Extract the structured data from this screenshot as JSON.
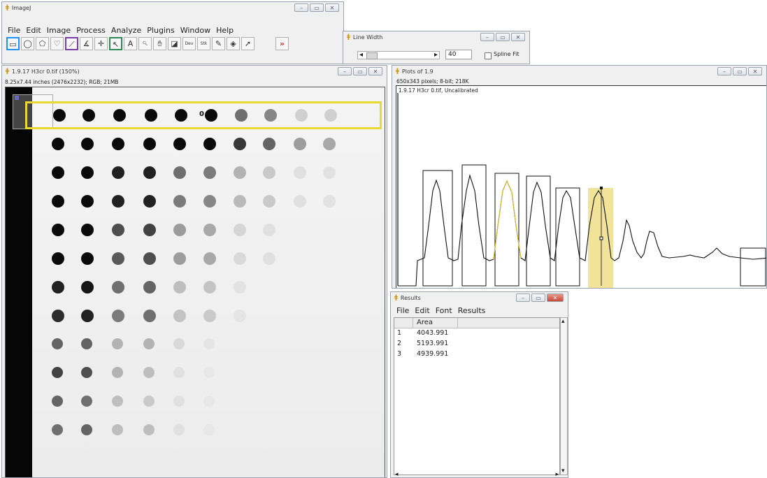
{
  "imagej": {
    "title": "ImageJ",
    "menu": [
      "File",
      "Edit",
      "Image",
      "Process",
      "Analyze",
      "Plugins",
      "Window",
      "Help"
    ],
    "tools": [
      {
        "name": "rectangle-tool-icon",
        "glyph": "▭",
        "highlight": "#1e90ff"
      },
      {
        "name": "oval-tool-icon",
        "glyph": "◯",
        "highlight": ""
      },
      {
        "name": "polygon-tool-icon",
        "glyph": "⬠",
        "highlight": ""
      },
      {
        "name": "freehand-tool-icon",
        "glyph": "♡",
        "highlight": ""
      },
      {
        "name": "straight-line-tool-icon",
        "glyph": "⟋",
        "highlight": "#7a3fa6"
      },
      {
        "name": "angle-tool-icon",
        "glyph": "∡",
        "highlight": ""
      },
      {
        "name": "point-tool-icon",
        "glyph": "✛",
        "highlight": ""
      },
      {
        "name": "wand-tool-icon",
        "glyph": "↖",
        "highlight": "#2e8b57"
      },
      {
        "name": "text-tool-icon",
        "glyph": "A",
        "highlight": ""
      },
      {
        "name": "magnifier-tool-icon",
        "glyph": "🔍︎",
        "highlight": ""
      },
      {
        "name": "hand-tool-icon",
        "glyph": "✋︎",
        "highlight": ""
      },
      {
        "name": "color-picker-tool-icon",
        "glyph": "◪",
        "highlight": ""
      },
      {
        "name": "developer-menu-tool-icon",
        "glyph": "Dev",
        "highlight": ""
      },
      {
        "name": "stacks-menu-tool-icon",
        "glyph": "Stk",
        "highlight": ""
      },
      {
        "name": "brush-tool-icon",
        "glyph": "✎",
        "highlight": ""
      },
      {
        "name": "flood-fill-tool-icon",
        "glyph": "◈",
        "highlight": ""
      },
      {
        "name": "arrow-tool-icon",
        "glyph": "➚",
        "highlight": ""
      },
      {
        "name": "more-tools-icon",
        "glyph": "»",
        "highlight": ""
      }
    ]
  },
  "line_width": {
    "title": "Line Width",
    "value": "40",
    "spline_label": "Spline Fit",
    "scroll_left": "◂",
    "scroll_right": "▸"
  },
  "image_window": {
    "title": "1.9.17 H3cr 0.tif (150%)",
    "info": "8.25x7.44 inches (2476x2232); RGB; 21MB",
    "selection_color": "#e8d830",
    "lane_number": "0"
  },
  "plot_window": {
    "title": "Plots of 1.9",
    "info": "650x343 pixels; 8-bit; 218K",
    "label": "1.9.17 H3cr 0.tif, Uncalibrated",
    "highlight_color": "#f2e39a"
  },
  "results": {
    "title": "Results",
    "menu": [
      "File",
      "Edit",
      "Font",
      "Results"
    ],
    "column": "Area",
    "rows": [
      {
        "n": "1",
        "area": "4043.991"
      },
      {
        "n": "2",
        "area": "5193.991"
      },
      {
        "n": "3",
        "area": "4939.991"
      }
    ],
    "scroll_up": "▴",
    "scroll_down": "▾",
    "scroll_left": "◂",
    "scroll_right": "▸"
  },
  "window_buttons": {
    "min": "–",
    "max": "▭",
    "close": "✕"
  }
}
